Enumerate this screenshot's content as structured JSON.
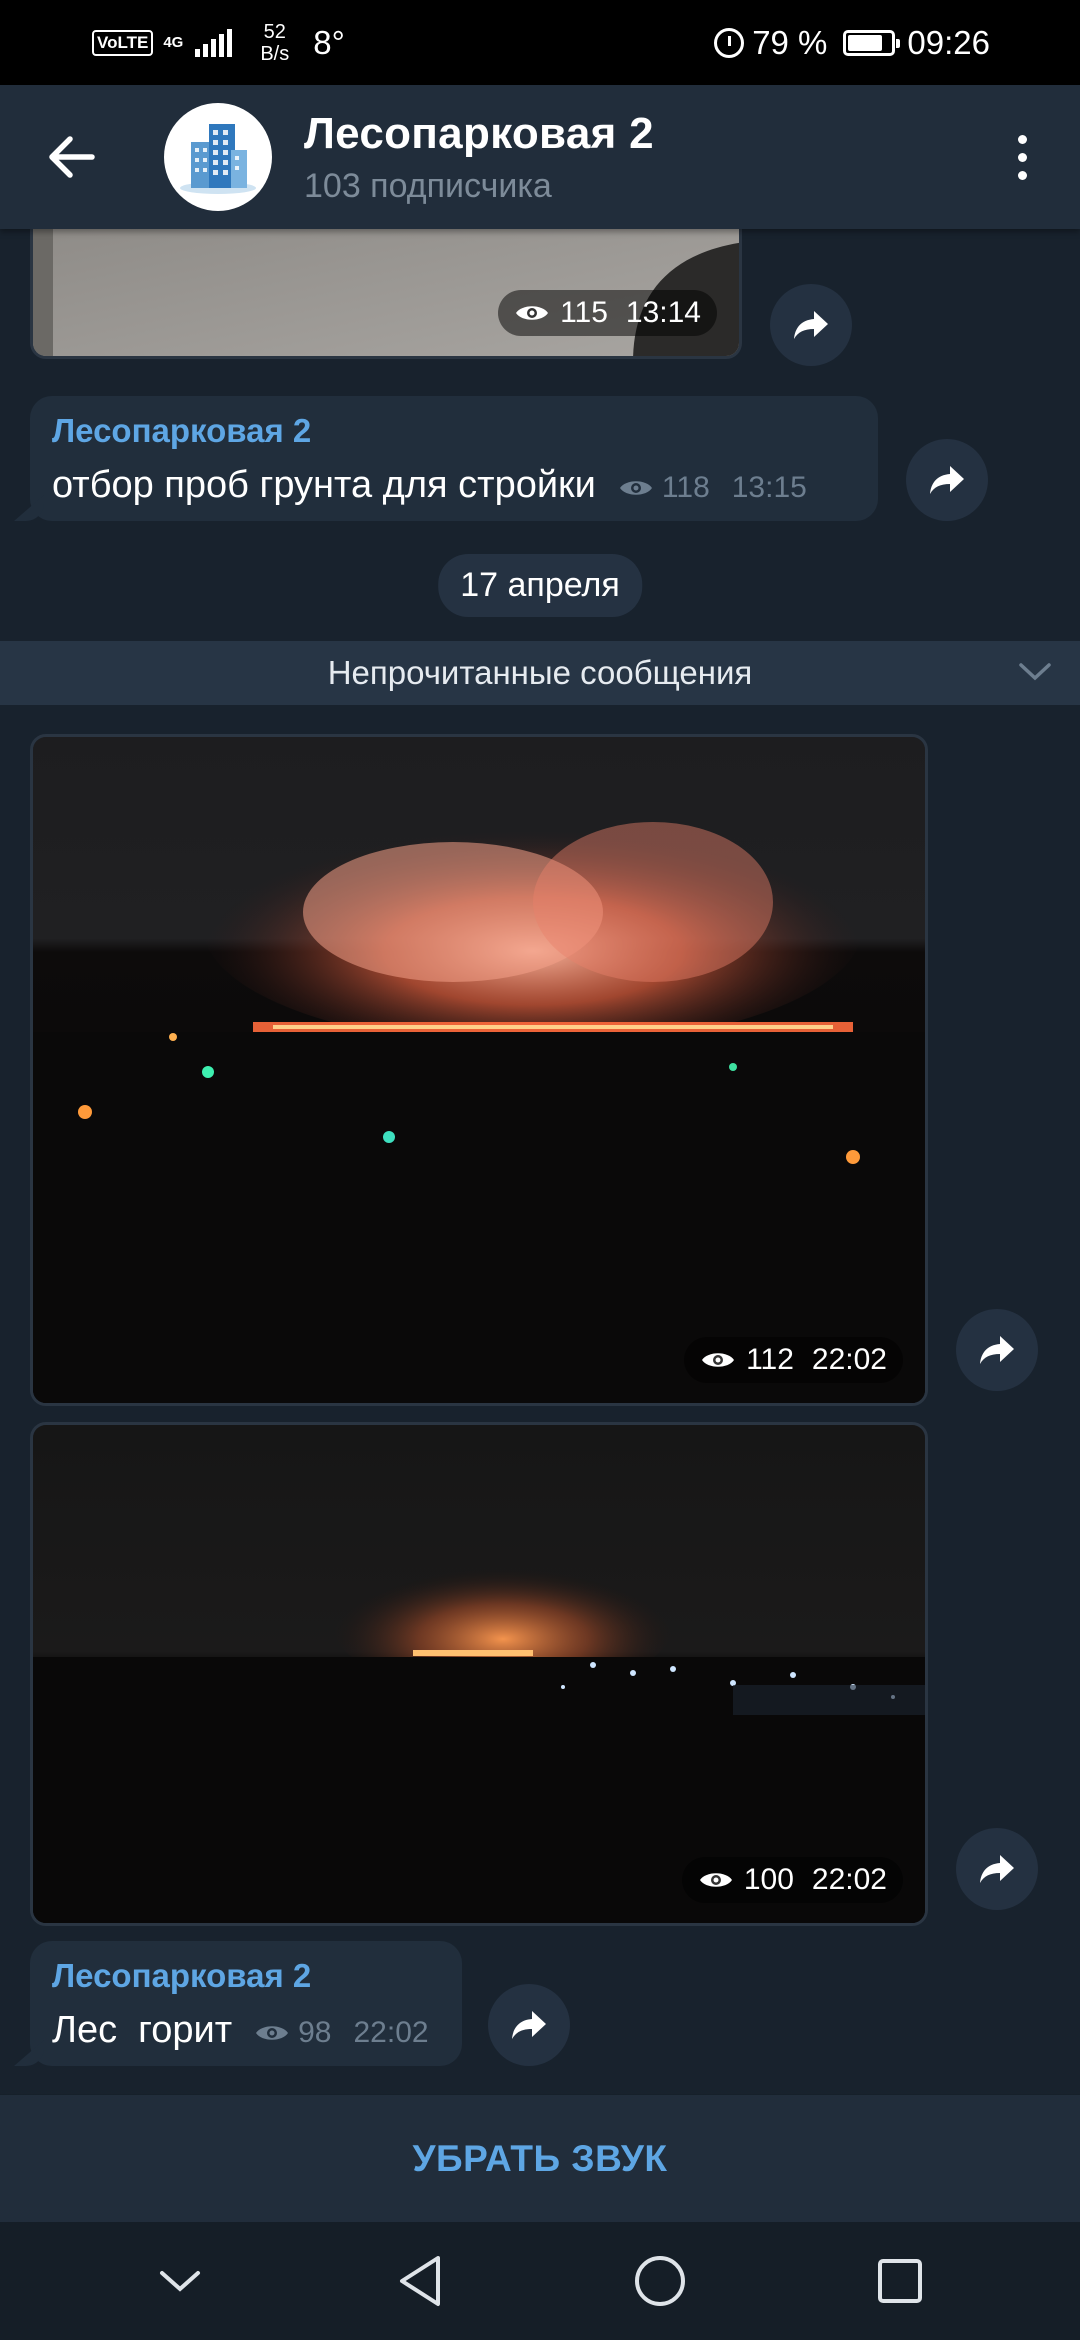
{
  "status_bar": {
    "volte": "VoLTE",
    "network": "4G",
    "net_speed_value": "52",
    "net_speed_unit": "B/s",
    "temperature": "8°",
    "battery": "79 %",
    "time": "09:26",
    "icons": [
      "alarm-icon",
      "battery-icon",
      "signal-icon"
    ]
  },
  "header": {
    "title": "Лесопарковая 2",
    "subtitle": "103 подписчика",
    "back_icon": "arrow-left-icon",
    "menu_icon": "more-vertical-icon"
  },
  "messages": {
    "photo1": {
      "views": "115",
      "time": "13:14"
    },
    "text1": {
      "author": "Лесопарковая 2",
      "text": "отбор проб грунта для стройки",
      "views": "118",
      "time": "13:15"
    },
    "date_separator": "17 апреля",
    "unread_label": "Непрочитанные сообщения",
    "photo2": {
      "views": "112",
      "time": "22:02"
    },
    "photo3": {
      "views": "100",
      "time": "22:02"
    },
    "text2": {
      "author": "Лесопарковая 2",
      "text": "Лес  горит",
      "views": "98",
      "time": "22:02"
    }
  },
  "mute_bar": {
    "label": "УБРАТЬ ЗВУК"
  },
  "nav_bar": {
    "icons": [
      "chevron-down-icon",
      "back-triangle-icon",
      "home-circle-icon",
      "recents-square-icon"
    ]
  },
  "colors": {
    "background": "#18222d",
    "header": "#212d3b",
    "bubble": "#212e3c",
    "accent": "#5ea6e4",
    "meta": "#6d7e8f"
  }
}
